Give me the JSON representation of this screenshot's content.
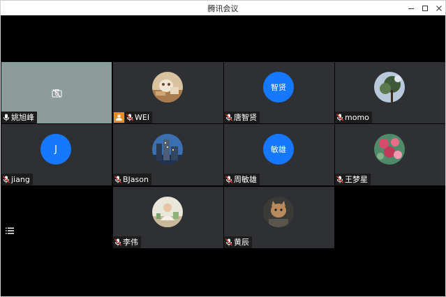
{
  "window": {
    "title": "腾讯会议"
  },
  "participants": [
    {
      "name": "姚旭峰",
      "avatar": "camera-off",
      "self": true
    },
    {
      "name": "WEI",
      "avatar": "photo-kitten",
      "host": true
    },
    {
      "name": "唐智贤",
      "avatar": "text",
      "avatar_text": "智贤"
    },
    {
      "name": "momo",
      "avatar": "photo-tree"
    },
    {
      "name": "jiang",
      "avatar": "text",
      "avatar_text": "J"
    },
    {
      "name": "BJason",
      "avatar": "photo-city"
    },
    {
      "name": "周敏雄",
      "avatar": "text",
      "avatar_text": "敏雄"
    },
    {
      "name": "王梦星",
      "avatar": "photo-flowers"
    },
    {
      "name": "李伟",
      "avatar": "photo-room"
    },
    {
      "name": "黄辰",
      "avatar": "photo-cat"
    }
  ],
  "colors": {
    "avatar_blue": "#1677ff",
    "tile_bg": "#2e3033",
    "self_tile_bg": "#8e9b9b",
    "host_badge": "#f08a24"
  }
}
